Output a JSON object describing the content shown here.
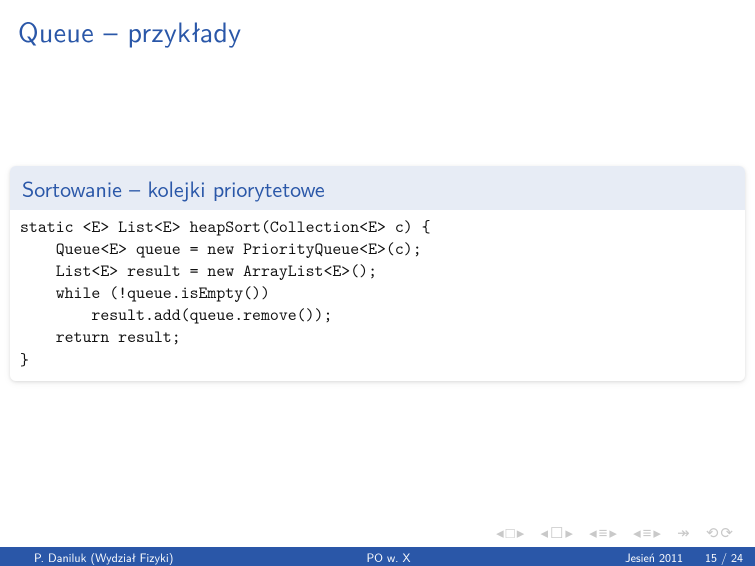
{
  "title": "Queue – przykłady",
  "block": {
    "title": "Sortowanie – kolejki priorytetowe",
    "code": "static <E> List<E> heapSort(Collection<E> c) {\n    Queue<E> queue = new PriorityQueue<E>(c);\n    List<E> result = new ArrayList<E>();\n    while (!queue.isEmpty())\n        result.add(queue.remove());\n    return result;\n}"
  },
  "nav": {
    "first": "◂□▸",
    "prevsec": "◂☐▸",
    "prev": "◂≡▸",
    "next": "◂≡▸",
    "last": "↠",
    "undo": "⟲⟳"
  },
  "footer": {
    "author": "P. Daniluk (Wydział Fizyki)",
    "short_title": "PO w. X",
    "date": "Jesień 2011",
    "page": "15 / 24"
  }
}
